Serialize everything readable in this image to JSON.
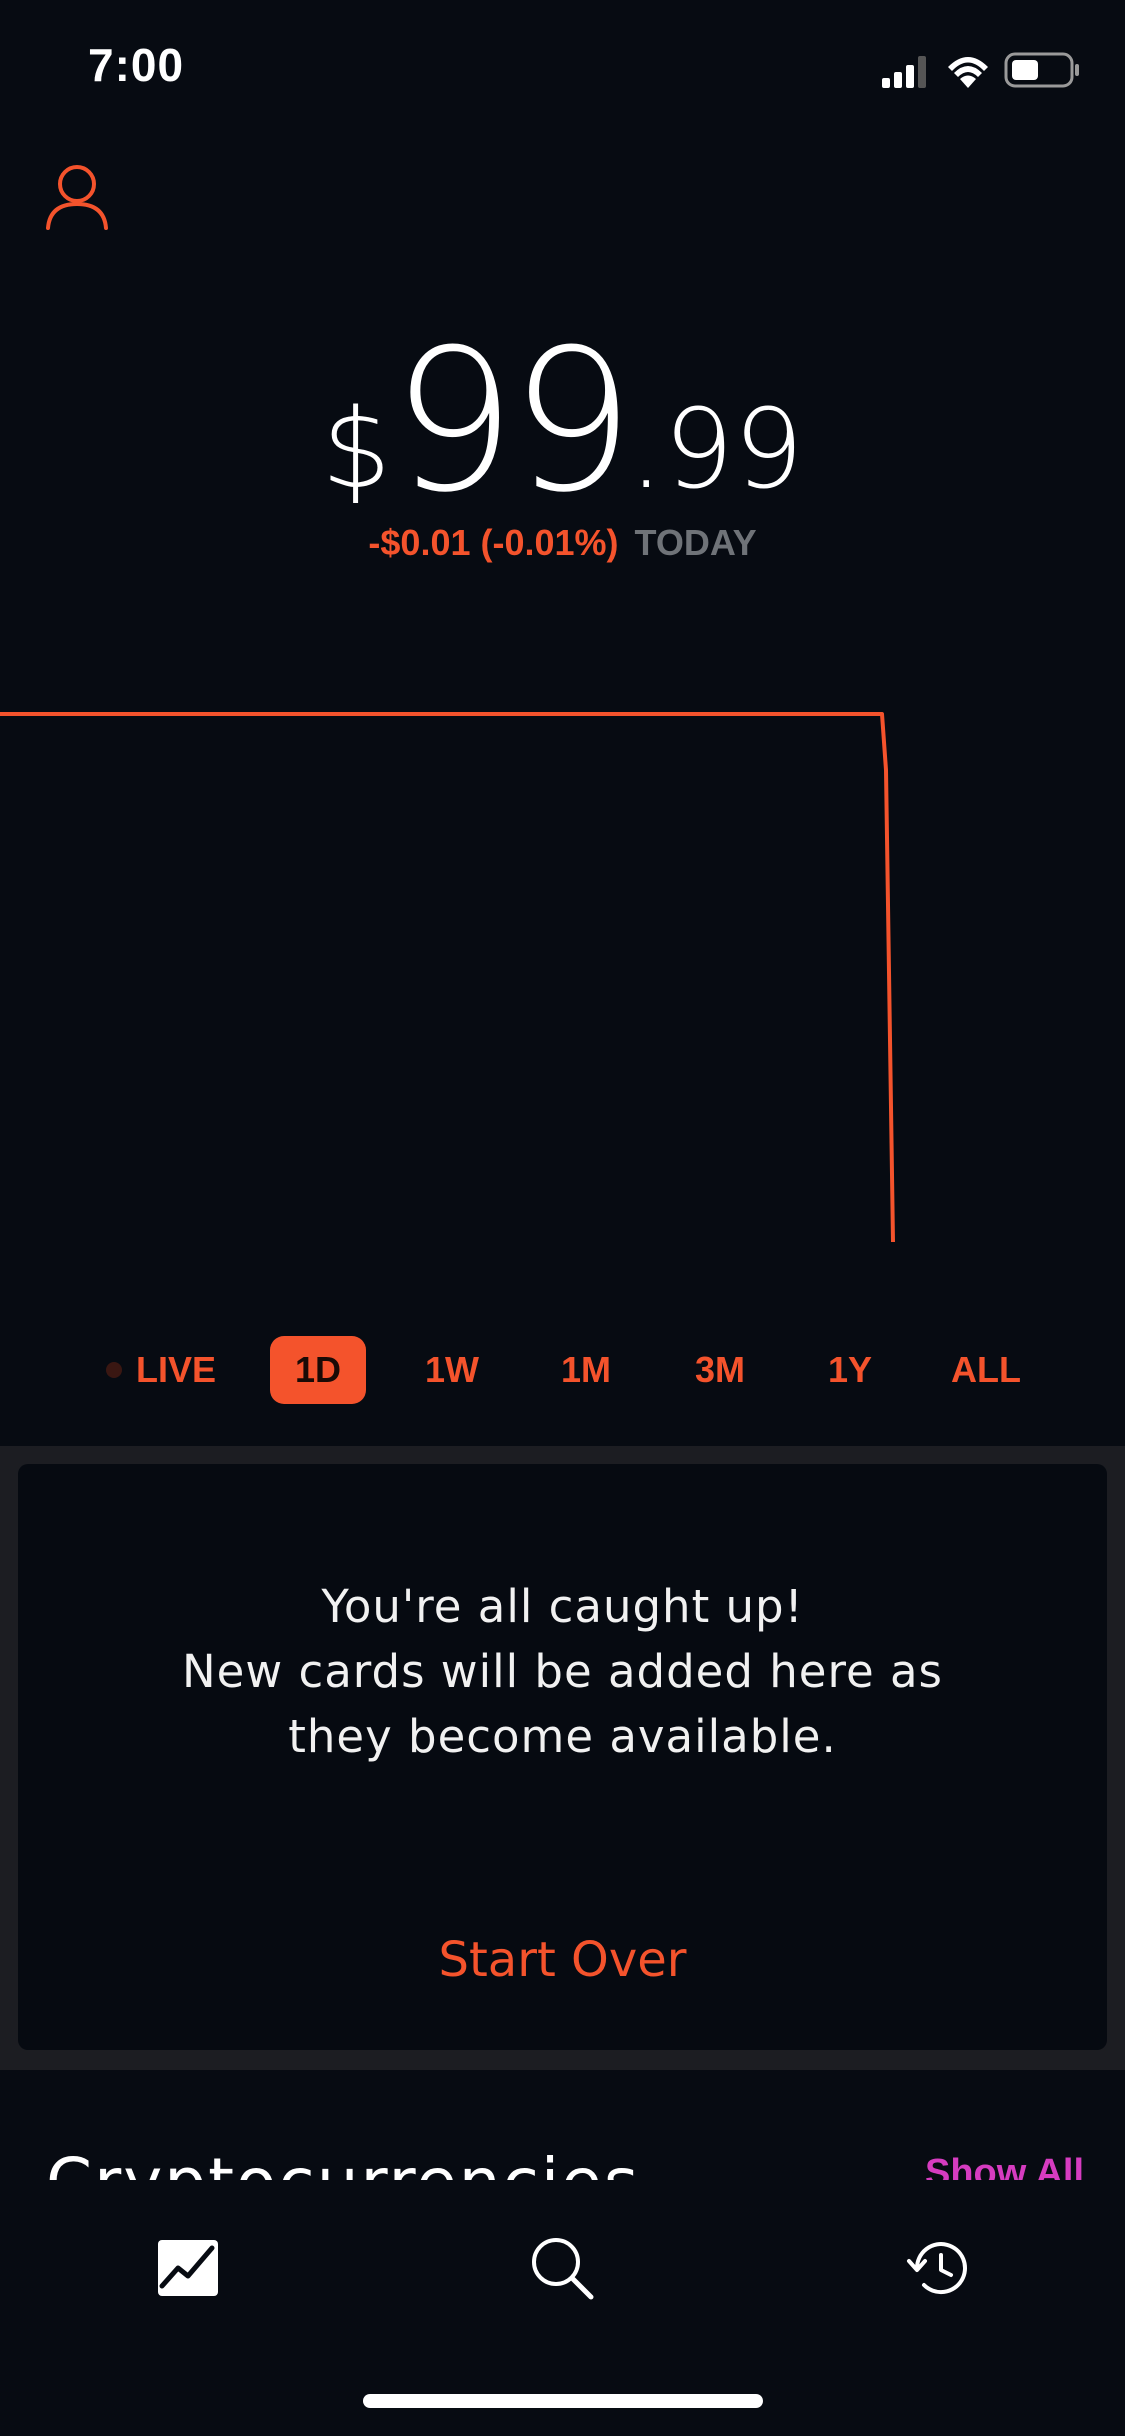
{
  "status_bar": {
    "time": "7:00"
  },
  "portfolio": {
    "dollar_sign": "$",
    "whole": "99",
    "cents": ".99",
    "change_amount": "-$0.01 (-0.01%)",
    "change_period": "TODAY"
  },
  "ranges": [
    {
      "label": "LIVE",
      "active": false
    },
    {
      "label": "1D",
      "active": true
    },
    {
      "label": "1W",
      "active": false
    },
    {
      "label": "1M",
      "active": false
    },
    {
      "label": "3M",
      "active": false
    },
    {
      "label": "1Y",
      "active": false
    },
    {
      "label": "ALL",
      "active": false
    }
  ],
  "card": {
    "line1": "You're all caught up!",
    "line2": "New cards will be added here as",
    "line3": "they become available.",
    "button": "Start Over"
  },
  "section": {
    "title": "Cryptocurrencies",
    "show_all": "Show All"
  },
  "nav": {
    "items": [
      "chart-icon",
      "search-icon",
      "history-icon"
    ]
  },
  "colors": {
    "accent": "#f4532c",
    "background": "#070b12",
    "show_all": "#d63cc0"
  }
}
